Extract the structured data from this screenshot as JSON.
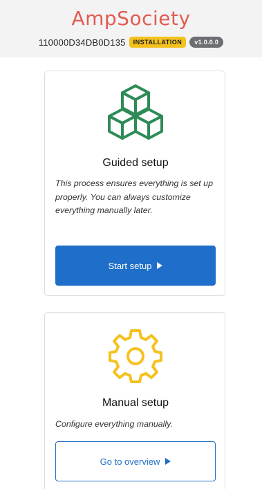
{
  "header": {
    "brand": "AmpSociety",
    "device_id": "110000D34DB0D135",
    "status_badge": "INSTALLATION",
    "version_badge": "v1.0.0.0"
  },
  "guided": {
    "icon": "cubes-icon",
    "title": "Guided setup",
    "description": "This process ensures everything is set up properly. You can always customize everything manually later.",
    "button_label": "Start setup"
  },
  "manual": {
    "icon": "gear-icon",
    "title": "Manual setup",
    "description": "Configure everything manually.",
    "button_label": "Go to overview"
  },
  "colors": {
    "brand": "#e25b52",
    "primary": "#1f6ec9",
    "install_badge": "#f4c21f",
    "version_badge": "#6c6e72",
    "cubes": "#2e8b57",
    "gear": "#f4c21f"
  }
}
